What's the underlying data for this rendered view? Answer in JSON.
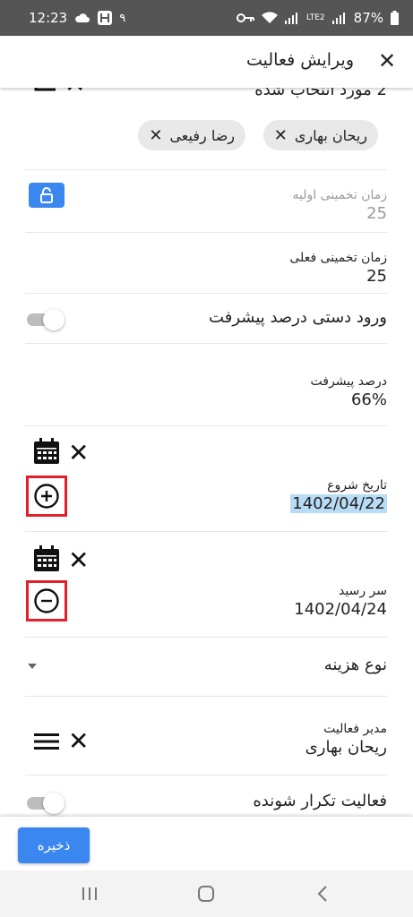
{
  "status_bar": {
    "time": "12:23",
    "extra": "۹",
    "battery": "87%",
    "network": "LTE2"
  },
  "header": {
    "title": "ویرایش فعالیت",
    "close_symbol": "✕"
  },
  "assignees": {
    "selected_count_text": "2 مورد انتخاب شده",
    "chips": [
      {
        "label": "ریحان بهاری"
      },
      {
        "label": "رضا رفیعی"
      }
    ]
  },
  "initial_estimate": {
    "label": "زمان تخمینی اولیه",
    "value": "25",
    "icon": "unlock-icon"
  },
  "current_estimate": {
    "label": "زمان تخمینی فعلی",
    "value": "25"
  },
  "manual_progress": {
    "label": "ورود دستی درصد پیشرفت",
    "enabled": false
  },
  "progress": {
    "label": "درصد پیشرفت",
    "value": "66%"
  },
  "start_date": {
    "label": "تاریخ شروع",
    "value": "1402/04/22"
  },
  "due_date": {
    "label": "سر رسید",
    "value": "1402/04/24"
  },
  "cost_type": {
    "label": "نوع هزینه"
  },
  "activity_manager": {
    "label": "مدیر فعالیت",
    "value": "ریحان بهاری"
  },
  "recurring": {
    "label": "فعالیت تکرار شونده",
    "enabled": false
  },
  "save": {
    "label": "ذخیره"
  },
  "colors": {
    "accent": "#3b87f0",
    "highlight_box": "#e0202a",
    "selection": "#b9dcf6"
  }
}
